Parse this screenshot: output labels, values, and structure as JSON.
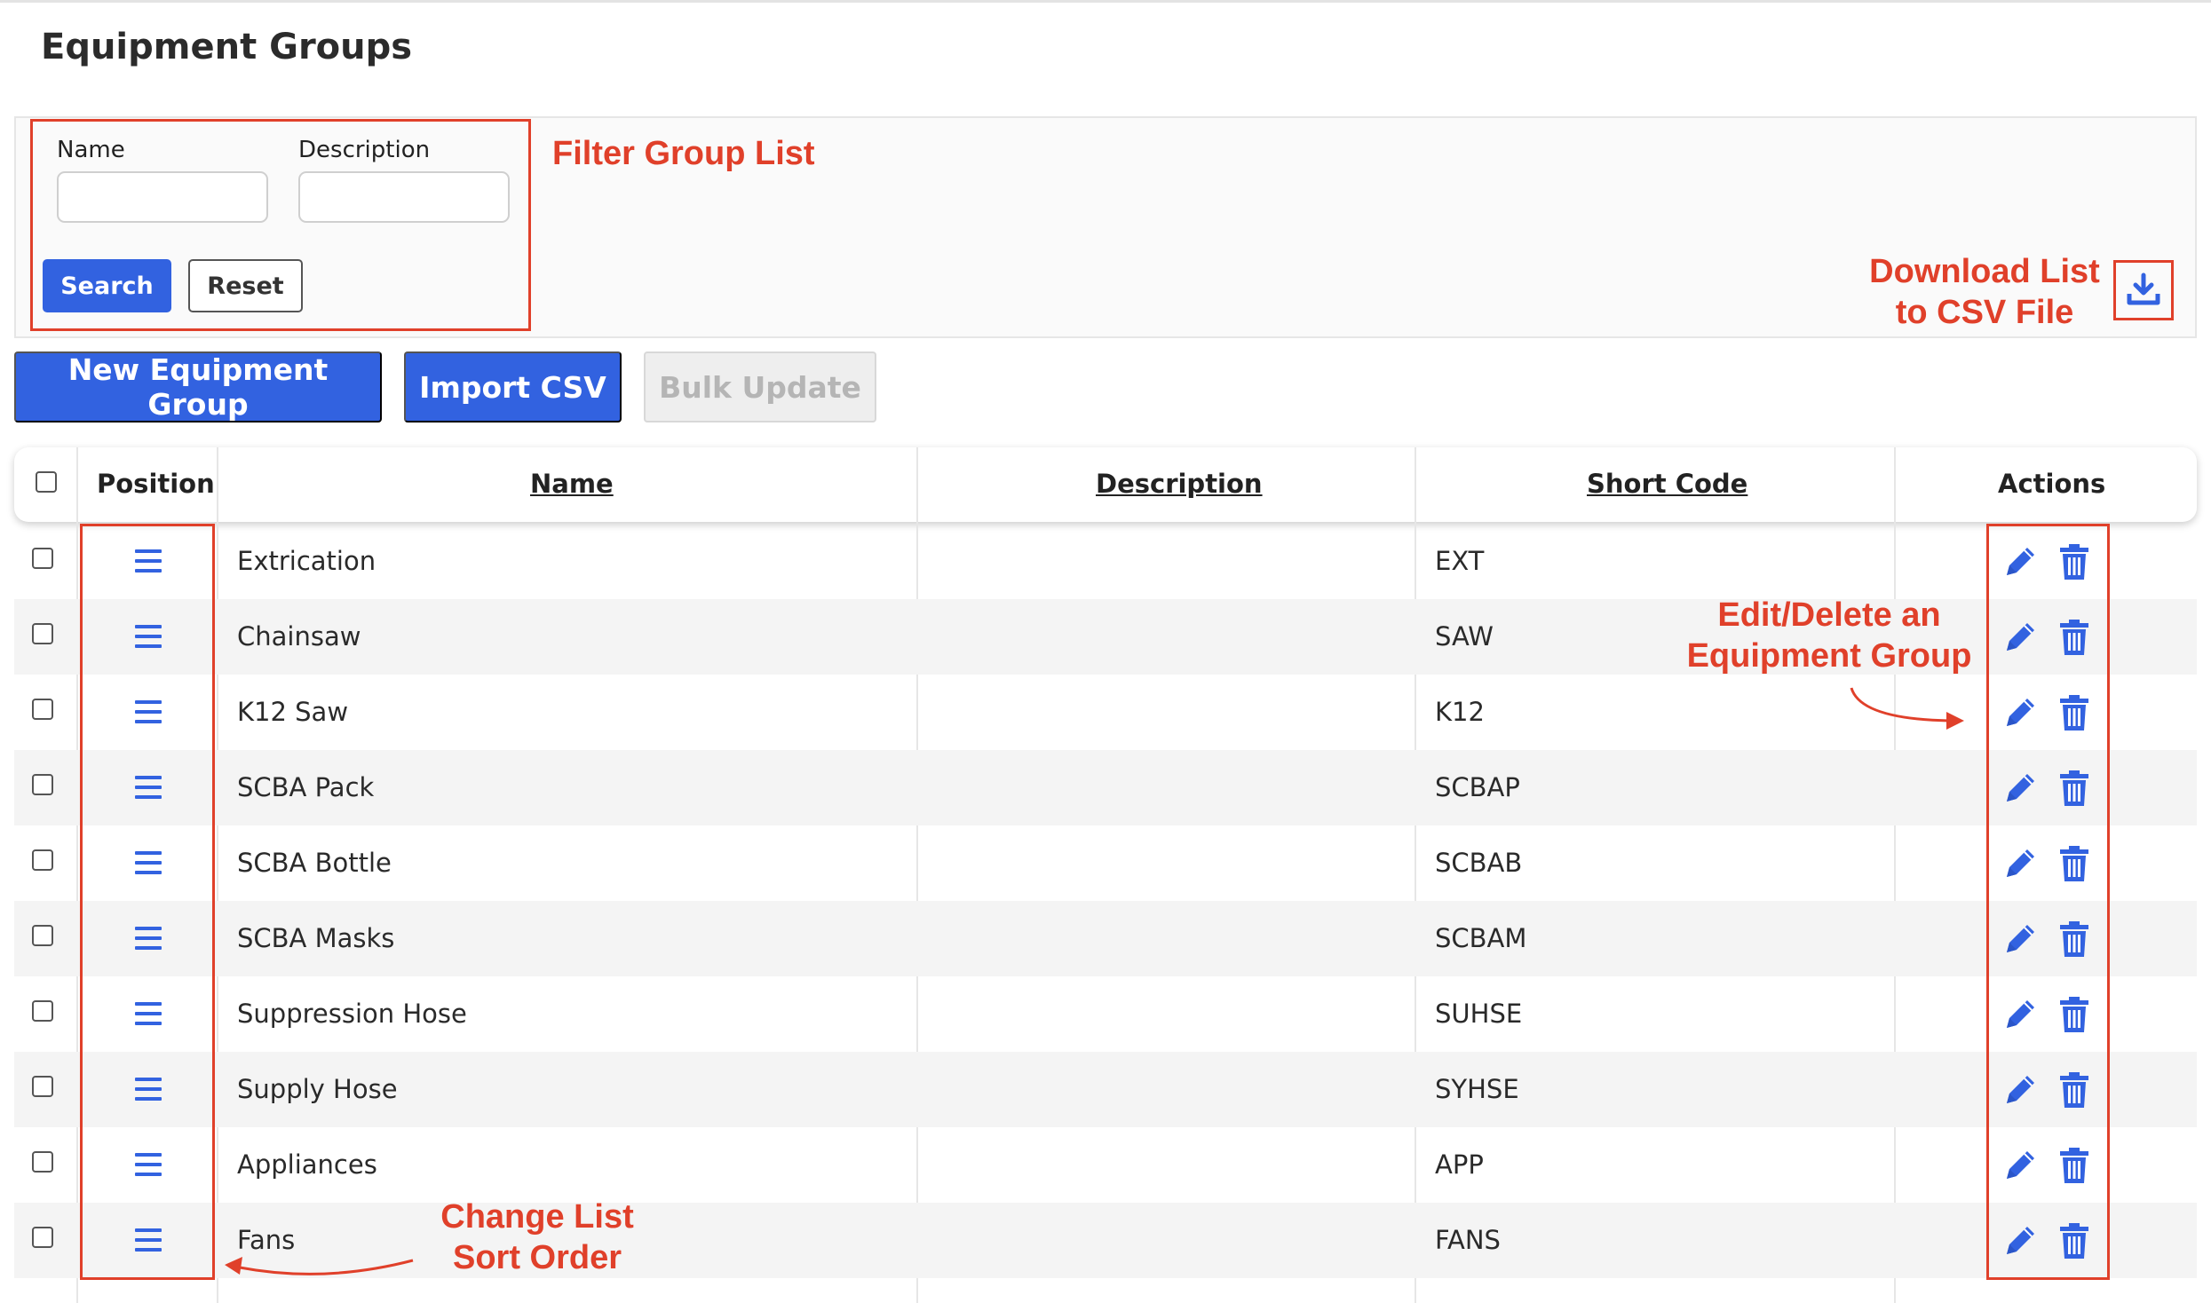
{
  "page": {
    "title": "Equipment Groups"
  },
  "filter": {
    "name_label": "Name",
    "description_label": "Description",
    "name_value": "",
    "description_value": "",
    "search_label": "Search",
    "reset_label": "Reset"
  },
  "toolbar": {
    "new_label": "New Equipment Group",
    "import_label": "Import CSV",
    "bulk_label": "Bulk Update"
  },
  "table": {
    "columns": [
      "Position",
      "Name",
      "Description",
      "Short Code",
      "Actions"
    ],
    "rows": [
      {
        "name": "Extrication",
        "description": "",
        "short_code": "EXT"
      },
      {
        "name": "Chainsaw",
        "description": "",
        "short_code": "SAW"
      },
      {
        "name": "K12 Saw",
        "description": "",
        "short_code": "K12"
      },
      {
        "name": "SCBA Pack",
        "description": "",
        "short_code": "SCBAP"
      },
      {
        "name": "SCBA Bottle",
        "description": "",
        "short_code": "SCBAB"
      },
      {
        "name": "SCBA Masks",
        "description": "",
        "short_code": "SCBAM"
      },
      {
        "name": "Suppression Hose",
        "description": "",
        "short_code": "SUHSE"
      },
      {
        "name": "Supply Hose",
        "description": "",
        "short_code": "SYHSE"
      },
      {
        "name": "Appliances",
        "description": "",
        "short_code": "APP"
      },
      {
        "name": "Fans",
        "description": "",
        "short_code": "FANS"
      }
    ]
  },
  "annotations": {
    "filter": "Filter Group List",
    "download_line1": "Download List",
    "download_line2": "to CSV File",
    "edit_line1": "Edit/Delete an",
    "edit_line2": "Equipment Group",
    "sort_line1": "Change List",
    "sort_line2": "Sort Order"
  },
  "colors": {
    "primary": "#3262e0",
    "annotation": "#e0402a",
    "row_alt": "#f4f4f4"
  },
  "icons": {
    "drag": "drag-handle-icon",
    "edit": "pencil-icon",
    "delete": "trash-icon",
    "download": "download-icon"
  }
}
